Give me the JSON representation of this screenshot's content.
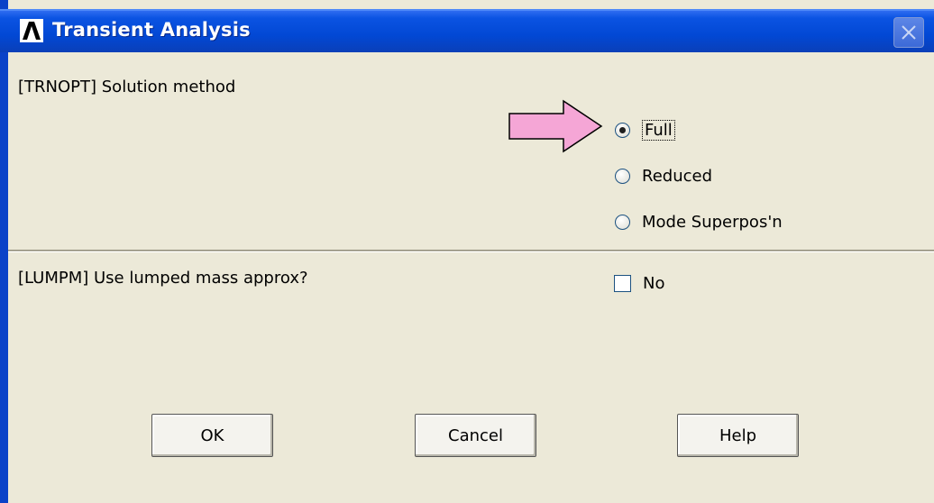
{
  "window": {
    "title": "Transient Analysis",
    "logo_icon": "ansys-logo-icon",
    "close_icon": "close-icon"
  },
  "solution": {
    "label": "[TRNOPT]  Solution method",
    "options": [
      {
        "label": "Full",
        "checked": true
      },
      {
        "label": "Reduced",
        "checked": false
      },
      {
        "label": "Mode Superpos'n",
        "checked": false
      }
    ]
  },
  "lumpm": {
    "label": "[LUMPM]  Use lumped mass approx?",
    "checkbox_label": "No",
    "checked": false
  },
  "buttons": {
    "ok": "OK",
    "cancel": "Cancel",
    "help": "Help"
  },
  "annotation": {
    "arrow_color": "#f5a6d6",
    "icon": "pink-arrow-icon"
  }
}
